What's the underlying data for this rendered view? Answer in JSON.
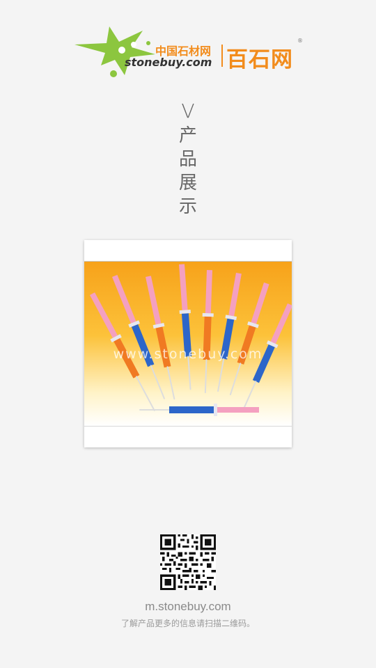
{
  "header": {
    "logo_cn_small": "中国石材网",
    "logo_url": "stonebuy.com",
    "logo_cn_big": "百石网",
    "logo_reg": "®"
  },
  "section": {
    "v_mark": "V",
    "title_chars": [
      "产",
      "品",
      "展",
      "示"
    ]
  },
  "product": {
    "watermark": "www.stonebuy.com"
  },
  "footer": {
    "site_url": "m.stonebuy.com",
    "hint": "了解产品更多的信息请扫描二维码。"
  },
  "colors": {
    "brand_orange": "#f28c1c",
    "brand_green": "#8cc63f",
    "background": "#f4f4f4"
  },
  "icons": {
    "logo_mark": "star-splash-logo-icon",
    "qr": "qr-code-icon"
  }
}
